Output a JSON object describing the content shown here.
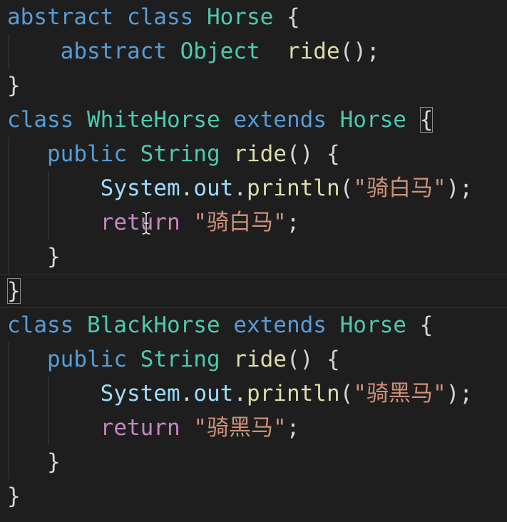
{
  "editor": {
    "language": "java",
    "theme_colors": {
      "background": "#1e1e1e",
      "keyword": "#569cd6",
      "control_keyword": "#c586c0",
      "type": "#4ec9b0",
      "function": "#dcdcaa",
      "variable": "#9cdcfe",
      "string": "#ce9178",
      "punctuation": "#d4d4d4"
    },
    "cursor_icon": "text-cursor-i-beam-icon",
    "lines": [
      {
        "tokens": [
          {
            "t": "abstract",
            "k": "keyword"
          },
          {
            "t": " "
          },
          {
            "t": "class",
            "k": "keyword"
          },
          {
            "t": " "
          },
          {
            "t": "Horse",
            "k": "type"
          },
          {
            "t": " "
          },
          {
            "t": "{",
            "k": "punct"
          }
        ]
      },
      {
        "tokens": [
          {
            "t": "    "
          },
          {
            "t": "abstract",
            "k": "keyword"
          },
          {
            "t": " "
          },
          {
            "t": "Object",
            "k": "type"
          },
          {
            "t": "  "
          },
          {
            "t": "ride",
            "k": "func"
          },
          {
            "t": "();",
            "k": "punct"
          }
        ]
      },
      {
        "tokens": [
          {
            "t": "}",
            "k": "punct"
          }
        ]
      },
      {
        "tokens": [
          {
            "t": "class",
            "k": "keyword"
          },
          {
            "t": " "
          },
          {
            "t": "WhiteHorse",
            "k": "type"
          },
          {
            "t": " "
          },
          {
            "t": "extends",
            "k": "keyword"
          },
          {
            "t": " "
          },
          {
            "t": "Horse",
            "k": "type"
          },
          {
            "t": " "
          },
          {
            "t": "{",
            "k": "punct",
            "match": true
          }
        ]
      },
      {
        "tokens": [
          {
            "t": "   "
          },
          {
            "t": "public",
            "k": "keyword"
          },
          {
            "t": " "
          },
          {
            "t": "String",
            "k": "type"
          },
          {
            "t": " "
          },
          {
            "t": "ride",
            "k": "func"
          },
          {
            "t": "() {",
            "k": "punct"
          }
        ]
      },
      {
        "tokens": [
          {
            "t": "       "
          },
          {
            "t": "System",
            "k": "var"
          },
          {
            "t": ".",
            "k": "punct"
          },
          {
            "t": "out",
            "k": "var"
          },
          {
            "t": ".",
            "k": "punct"
          },
          {
            "t": "println",
            "k": "func"
          },
          {
            "t": "(",
            "k": "punct"
          },
          {
            "t": "\"骑白马\"",
            "k": "string"
          },
          {
            "t": ");",
            "k": "punct"
          }
        ]
      },
      {
        "tokens": [
          {
            "t": "       "
          },
          {
            "t": "return",
            "k": "control"
          },
          {
            "t": " "
          },
          {
            "t": "\"骑白马\"",
            "k": "string"
          },
          {
            "t": ";",
            "k": "punct"
          }
        ]
      },
      {
        "tokens": [
          {
            "t": "   "
          },
          {
            "t": "}",
            "k": "punct"
          }
        ]
      },
      {
        "current": true,
        "tokens": [
          {
            "t": "}",
            "k": "punct",
            "match": true
          }
        ]
      },
      {
        "tokens": [
          {
            "t": "class",
            "k": "keyword"
          },
          {
            "t": " "
          },
          {
            "t": "BlackHorse",
            "k": "type"
          },
          {
            "t": " "
          },
          {
            "t": "extends",
            "k": "keyword"
          },
          {
            "t": " "
          },
          {
            "t": "Horse",
            "k": "type"
          },
          {
            "t": " "
          },
          {
            "t": "{",
            "k": "punct"
          }
        ]
      },
      {
        "tokens": [
          {
            "t": "   "
          },
          {
            "t": "public",
            "k": "keyword"
          },
          {
            "t": " "
          },
          {
            "t": "String",
            "k": "type"
          },
          {
            "t": " "
          },
          {
            "t": "ride",
            "k": "func"
          },
          {
            "t": "() {",
            "k": "punct"
          }
        ]
      },
      {
        "tokens": [
          {
            "t": "       "
          },
          {
            "t": "System",
            "k": "var"
          },
          {
            "t": ".",
            "k": "punct"
          },
          {
            "t": "out",
            "k": "var"
          },
          {
            "t": ".",
            "k": "punct"
          },
          {
            "t": "println",
            "k": "func"
          },
          {
            "t": "(",
            "k": "punct"
          },
          {
            "t": "\"骑黑马\"",
            "k": "string"
          },
          {
            "t": ");",
            "k": "punct"
          }
        ]
      },
      {
        "tokens": [
          {
            "t": "       "
          },
          {
            "t": "return",
            "k": "control"
          },
          {
            "t": " "
          },
          {
            "t": "\"骑黑马\"",
            "k": "string"
          },
          {
            "t": ";",
            "k": "punct"
          }
        ]
      },
      {
        "tokens": [
          {
            "t": "   "
          },
          {
            "t": "}",
            "k": "punct"
          }
        ]
      },
      {
        "tokens": [
          {
            "t": "}",
            "k": "punct"
          }
        ]
      }
    ]
  }
}
